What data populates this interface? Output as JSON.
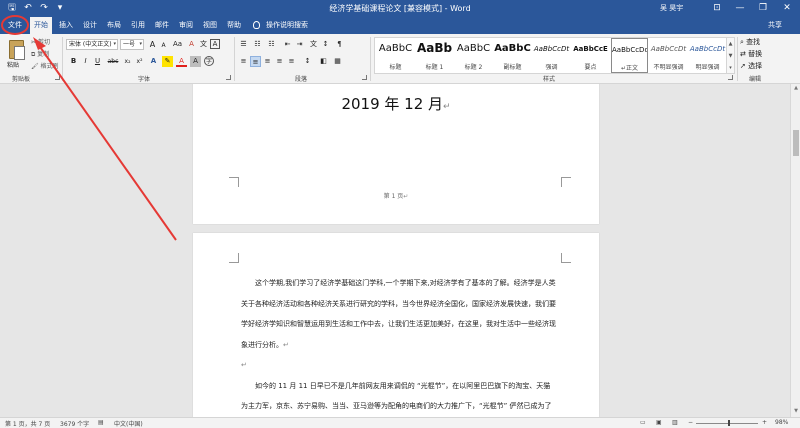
{
  "titlebar": {
    "doc_title": "经济学基础课程论文 [兼容模式] - Word",
    "user": "吴 昊宇",
    "qa_save": "🖫",
    "qa_undo": "↶",
    "qa_redo": "↷",
    "qa_more": "▾",
    "btn_options": "⊡",
    "btn_min": "—",
    "btn_max": "❐",
    "btn_close": "✕"
  },
  "tabs": [
    "文件",
    "开始",
    "插入",
    "设计",
    "布局",
    "引用",
    "邮件",
    "审阅",
    "视图",
    "帮助"
  ],
  "tellme": "操作说明搜索",
  "share": "共享",
  "clipboard": {
    "paste": "粘贴",
    "cut": "剪切",
    "copy": "复制",
    "format_painter": "格式刷",
    "label": "剪贴板"
  },
  "font": {
    "name": "宋体 (中文正文)",
    "size": "一号",
    "label": "字体",
    "btn_grow": "A",
    "btn_shrink": "A",
    "btn_case": "Aa",
    "btn_clear": "A",
    "btn_phonetic": "文",
    "btn_border": "A",
    "btn_bold": "B",
    "btn_italic": "I",
    "btn_underline": "U",
    "btn_strike": "abc",
    "btn_sub": "x₂",
    "btn_sup": "x²",
    "btn_effects": "A",
    "btn_highlight": "✎",
    "btn_color": "A",
    "btn_shade": "A",
    "btn_enclose": "字"
  },
  "paragraph": {
    "label": "段落",
    "btn_bullets": "☰",
    "btn_numbering": "☷",
    "btn_multilevel": "☷",
    "btn_decrease": "⇤",
    "btn_increase": "⇥",
    "btn_chinese": "文",
    "btn_sort": "↕",
    "btn_marks": "¶",
    "btn_left": "≡",
    "btn_center": "≡",
    "btn_right": "≡",
    "btn_justify": "≡",
    "btn_distributed": "≡",
    "btn_spacing": "↕",
    "btn_shading": "◧",
    "btn_borders": "▦"
  },
  "styles": {
    "label": "样式",
    "items": [
      {
        "preview": "AaBbC",
        "name": "标题"
      },
      {
        "preview": "AaBb",
        "name": "标题 1"
      },
      {
        "preview": "AaBbC",
        "name": "标题 2"
      },
      {
        "preview": "AaBbC",
        "name": "副标题"
      },
      {
        "preview": "AaBbCcDt",
        "name": "强调"
      },
      {
        "preview": "AaBbCcE",
        "name": "要点"
      },
      {
        "preview": "AaBbCcDd",
        "name": "↵正文"
      },
      {
        "preview": "AaBbCcDt",
        "name": "不明显强调"
      },
      {
        "preview": "AaBbCcDt",
        "name": "明显强调"
      }
    ]
  },
  "editing": {
    "label": "编辑",
    "find": "查找",
    "replace": "替换",
    "select": "选择"
  },
  "page1": {
    "date": "2019 年 12 月",
    "date_mark": "↵",
    "page_num": "第 1 页",
    "page_num_mark": "↵"
  },
  "page2": {
    "para1_line1": "这个学期,我们学习了经济学基础这门学科,一个学期下来,对经济学有了基本的了解。经济学是人类",
    "para1_line2": "关于各种经济活动和各种经济关系进行研究的学科，当今世界经济全国化，国家经济发展快速，我们要",
    "para1_line3": "学好经济学知识和智慧运用到生活和工作中去，让我们生活更加美好，在这里，我对生活中一些经济现",
    "para1_line4": "象进行分析。",
    "para1_mark": "↵",
    "empty_mark": "↵",
    "para2_line1": "如今的 11 月 11 日早已不是几年前网友用来调侃的 “光棍节”，在以阿里巴巴旗下的淘宝、天猫",
    "para2_line2": "为主力军，京东、苏宁易购、当当、亚马逊等为配角的电商们的大力推广下，“光棍节” 俨然已成为了"
  },
  "status": {
    "page": "第 1 页，共 7 页",
    "words": "3679 个字",
    "proof": "中文(中国)",
    "zoom_minus": "−",
    "zoom_plus": "+",
    "zoom": "98%"
  },
  "colors": {
    "title_blue": "#2b579a",
    "annotation_red": "#e53935",
    "font_color_red": "#e0201b"
  }
}
